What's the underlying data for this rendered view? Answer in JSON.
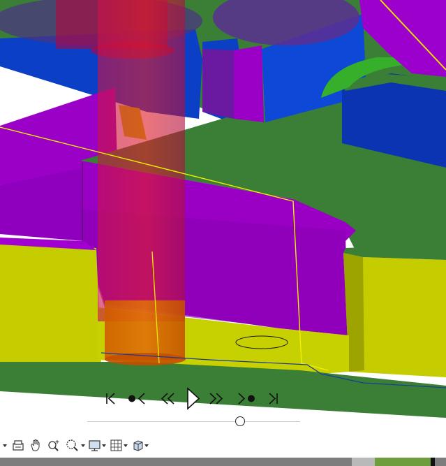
{
  "app": {
    "view": "3d-toolpath-simulation"
  },
  "playback": {
    "buttons": [
      {
        "id": "go-to-start",
        "icon": "skip-to-start-icon"
      },
      {
        "id": "previous-point",
        "icon": "step-back-point-icon"
      },
      {
        "id": "rewind",
        "icon": "rewind-icon"
      },
      {
        "id": "play",
        "icon": "play-icon"
      },
      {
        "id": "fast-forward",
        "icon": "fast-forward-icon"
      },
      {
        "id": "next-point",
        "icon": "step-forward-point-icon"
      },
      {
        "id": "go-to-end",
        "icon": "skip-to-end-icon"
      }
    ],
    "position_fraction": 0.73
  },
  "toolbar": {
    "buttons": [
      {
        "id": "collapse",
        "icon": "dropdown-arrow-icon"
      },
      {
        "id": "print",
        "icon": "printer-icon"
      },
      {
        "id": "pan",
        "icon": "hand-icon"
      },
      {
        "id": "zoom-window",
        "icon": "zoom-window-icon"
      },
      {
        "id": "zoom",
        "icon": "zoom-icon"
      },
      {
        "id": "display",
        "icon": "monitor-icon"
      },
      {
        "id": "grid",
        "icon": "grid-icon"
      },
      {
        "id": "view-cube",
        "icon": "view-cube-icon"
      }
    ]
  },
  "colors": {
    "green_floor": "#3a7f35",
    "blue_wall": "#0b3fc4",
    "purple_wall": "#9b00c8",
    "yellow_wall": "#c4cc00",
    "bright_green": "#36b02a",
    "tool_red": "#d7001e",
    "toolpath_yellow": "#f0f000"
  },
  "statusbar": {
    "segments": [
      "#7d7d7d",
      "#b9b9b9",
      "#6d9d3c",
      "#111111"
    ]
  }
}
